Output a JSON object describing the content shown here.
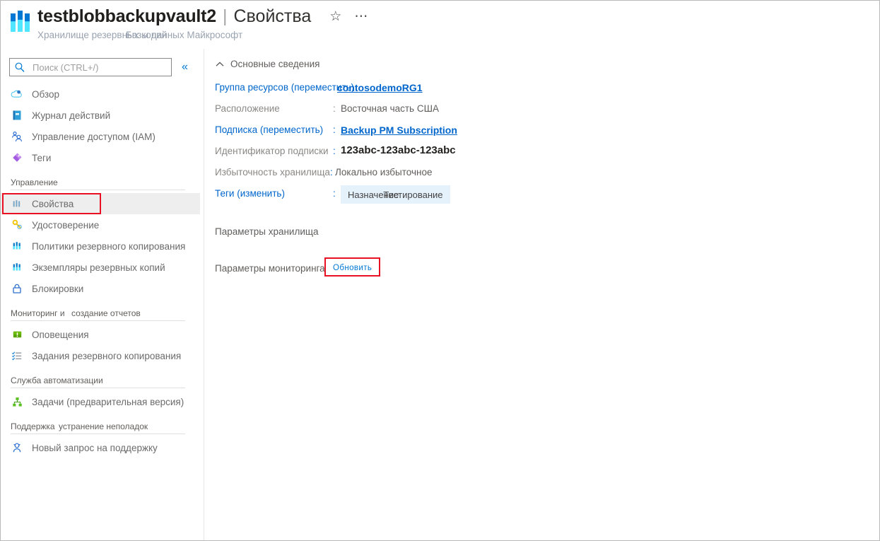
{
  "header": {
    "resource_name": "testblobbackupvault2",
    "separator": "|",
    "page_title": "Свойства",
    "subtitle_primary": "Хранилище резервных копий",
    "subtitle_secondary": "Базы данных Майкрософт",
    "star_icon": "star-icon",
    "more_icon": "ellipsis-icon",
    "logo_icon": "backup-vault-icon"
  },
  "sidebar": {
    "search": {
      "placeholder": "Поиск (CTRL+/)",
      "value": "",
      "icon": "search-icon"
    },
    "collapse_label": "«",
    "top_items": [
      {
        "label": "Обзор",
        "icon": "cloud-icon",
        "name": "sidebar-item-overview"
      },
      {
        "label": "Журнал действий",
        "icon": "activity-log-icon",
        "name": "sidebar-item-activity-log"
      },
      {
        "label": "Управление доступом (IAM)",
        "icon": "access-control-icon",
        "name": "sidebar-item-access-control"
      },
      {
        "label": "Теги",
        "icon": "tag-icon",
        "name": "sidebar-item-tags"
      }
    ],
    "groups": [
      {
        "title": "Управление",
        "title_part_1": "Управление",
        "title_part_2": "",
        "items": [
          {
            "label": "Свойства",
            "icon": "properties-icon",
            "name": "sidebar-item-properties",
            "selected": true,
            "highlighted": true
          },
          {
            "label": "Удостоверение",
            "icon": "identity-key-icon",
            "name": "sidebar-item-identity",
            "selected": false,
            "highlighted": false
          },
          {
            "label": "Политики резервного копирования",
            "icon": "backup-policies-icon",
            "name": "sidebar-item-backup-policies",
            "selected": false,
            "highlighted": false
          },
          {
            "label": "Экземпляры резервных копий",
            "icon": "backup-instances-icon",
            "name": "sidebar-item-backup-instances",
            "selected": false,
            "highlighted": false
          },
          {
            "label": "Блокировки",
            "icon": "lock-icon",
            "name": "sidebar-item-locks",
            "selected": false,
            "highlighted": false
          }
        ]
      },
      {
        "title": "Мониторинг и создание отчетов",
        "title_part_1": "Мониторинг и",
        "title_part_2": "создание отчетов",
        "items": [
          {
            "label": "Оповещения",
            "icon": "alerts-icon",
            "name": "sidebar-item-alerts",
            "selected": false,
            "highlighted": false
          },
          {
            "label": "Задания резервного копирования",
            "icon": "backup-jobs-icon",
            "name": "sidebar-item-backup-jobs",
            "selected": false,
            "highlighted": false
          }
        ]
      },
      {
        "title": "Служба автоматизации",
        "title_part_1": "Служба автоматизации",
        "title_part_2": "",
        "items": [
          {
            "label": "Задачи (предварительная версия)",
            "icon": "tasks-icon",
            "name": "sidebar-item-tasks",
            "selected": false,
            "highlighted": false
          }
        ]
      },
      {
        "title": "Поддержка и устранение неполадок",
        "title_part_1": "Поддержка",
        "title_part_2": "устранение неполадок",
        "items": [
          {
            "label": "Новый запрос на поддержку",
            "icon": "support-request-icon",
            "name": "sidebar-item-new-support-request",
            "selected": false,
            "highlighted": false
          }
        ]
      }
    ]
  },
  "main": {
    "essentials_section": {
      "label": "Основные сведения",
      "chevron_icon": "chevron-up-icon"
    },
    "properties": [
      {
        "label": "Группа ресурсов (переместить)",
        "colon": "",
        "value": "contosodemoRG1",
        "value_type": "link",
        "name": "property-resource-group"
      },
      {
        "label": "Расположение",
        "colon": ":",
        "value": "Восточная часть США",
        "value_type": "text",
        "name": "property-location"
      },
      {
        "label": "Подписка (переместить)",
        "colon": ":",
        "value": "Backup PM Subscription",
        "value_type": "link",
        "name": "property-subscription"
      },
      {
        "label": "Идентификатор подписки",
        "colon": ":",
        "value": "123abc-123abc-123abc",
        "value_type": "strong",
        "name": "property-subscription-id"
      },
      {
        "label": "Избыточность хранилища",
        "colon": ":",
        "value": "Локально избыточное",
        "value_type": "text",
        "name": "property-storage-redundancy"
      }
    ],
    "tags_row": {
      "label": "Теги (изменить)",
      "colon": ":",
      "tag_key": "Назначение",
      "tag_value": "Тестирование",
      "name": "property-tags"
    },
    "storage_settings": {
      "label": "Параметры хранилища"
    },
    "monitoring_settings": {
      "label": "Параметры мониторинга",
      "refresh_label": "Обновить"
    }
  },
  "colors": {
    "accent": "#0078d4",
    "link": "#0066cc",
    "highlight_box": "#e81123",
    "selected_row": "#eeeeee",
    "tag_chip": "#e5f1fb",
    "muted_text": "#8a8886"
  }
}
